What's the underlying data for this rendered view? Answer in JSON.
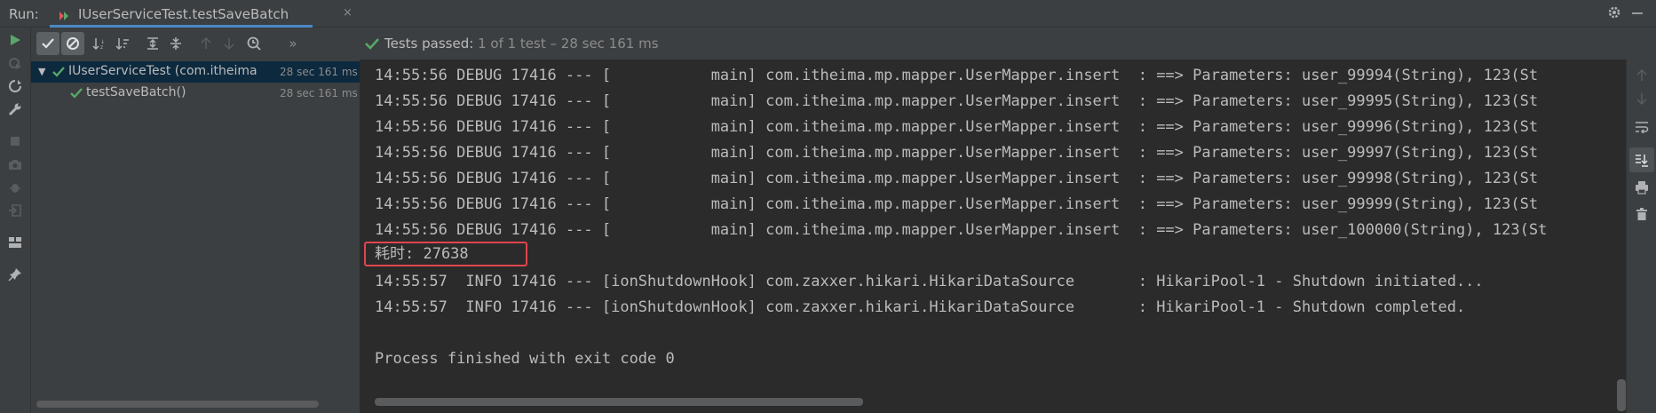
{
  "header": {
    "run_label": "Run:",
    "tab_title": "IUserServiceTest.testSaveBatch",
    "close_glyph": "×"
  },
  "test_toolbar": {
    "status_prefix": "Tests passed:",
    "status_count": "1",
    "status_detail": "of 1 test – 28 sec 161 ms",
    "more_glyph": "»"
  },
  "tree": {
    "root": {
      "label": "IUserServiceTest (com.itheima",
      "time": "28 sec 161 ms"
    },
    "child": {
      "label": "testSaveBatch()",
      "time": "28 sec 161 ms"
    }
  },
  "console": {
    "lines": [
      "14:55:56 DEBUG 17416 --- [           main] com.itheima.mp.mapper.UserMapper.insert  : ==> Parameters: user_99994(String), 123(St",
      "14:55:56 DEBUG 17416 --- [           main] com.itheima.mp.mapper.UserMapper.insert  : ==> Parameters: user_99995(String), 123(St",
      "14:55:56 DEBUG 17416 --- [           main] com.itheima.mp.mapper.UserMapper.insert  : ==> Parameters: user_99996(String), 123(St",
      "14:55:56 DEBUG 17416 --- [           main] com.itheima.mp.mapper.UserMapper.insert  : ==> Parameters: user_99997(String), 123(St",
      "14:55:56 DEBUG 17416 --- [           main] com.itheima.mp.mapper.UserMapper.insert  : ==> Parameters: user_99998(String), 123(St",
      "14:55:56 DEBUG 17416 --- [           main] com.itheima.mp.mapper.UserMapper.insert  : ==> Parameters: user_99999(String), 123(St",
      "14:55:56 DEBUG 17416 --- [           main] com.itheima.mp.mapper.UserMapper.insert  : ==> Parameters: user_100000(String), 123(St",
      "耗时: 27638",
      "14:55:57  INFO 17416 --- [ionShutdownHook] com.zaxxer.hikari.HikariDataSource       : HikariPool-1 - Shutdown initiated...",
      "14:55:57  INFO 17416 --- [ionShutdownHook] com.zaxxer.hikari.HikariDataSource       : HikariPool-1 - Shutdown completed.",
      "",
      "Process finished with exit code 0"
    ]
  },
  "colors": {
    "accent": "#4a88c7",
    "pass_green": "#59a869",
    "highlight_border": "#e0454f",
    "selection": "#0d293e"
  }
}
